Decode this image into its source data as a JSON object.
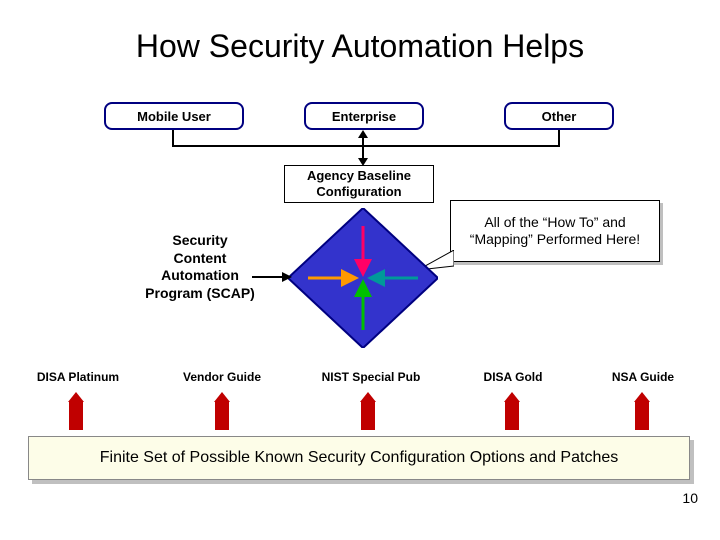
{
  "title": "How Security Automation Helps",
  "top_nodes": {
    "mobile_user": "Mobile User",
    "enterprise": "Enterprise",
    "other": "Other"
  },
  "agency_box": "Agency Baseline Configuration",
  "scap_label": "Security Content Automation Program (SCAP)",
  "callout": "All of the “How To” and “Mapping” Performed Here!",
  "bottom_labels": {
    "disa_platinum": "DISA Platinum",
    "vendor_guide": "Vendor Guide",
    "nist_pub": "NIST Special Pub",
    "disa_gold": "DISA Gold",
    "nsa_guide": "NSA Guide"
  },
  "banner": "Finite Set of Possible Known Security Configuration Options and Patches",
  "page_number": "10",
  "colors": {
    "pill_border": "#000080",
    "arrow_red": "#c00000",
    "banner_bg": "#fdfde8",
    "diamond_fill": "#3333cc",
    "diamond_stroke": "#000080"
  }
}
